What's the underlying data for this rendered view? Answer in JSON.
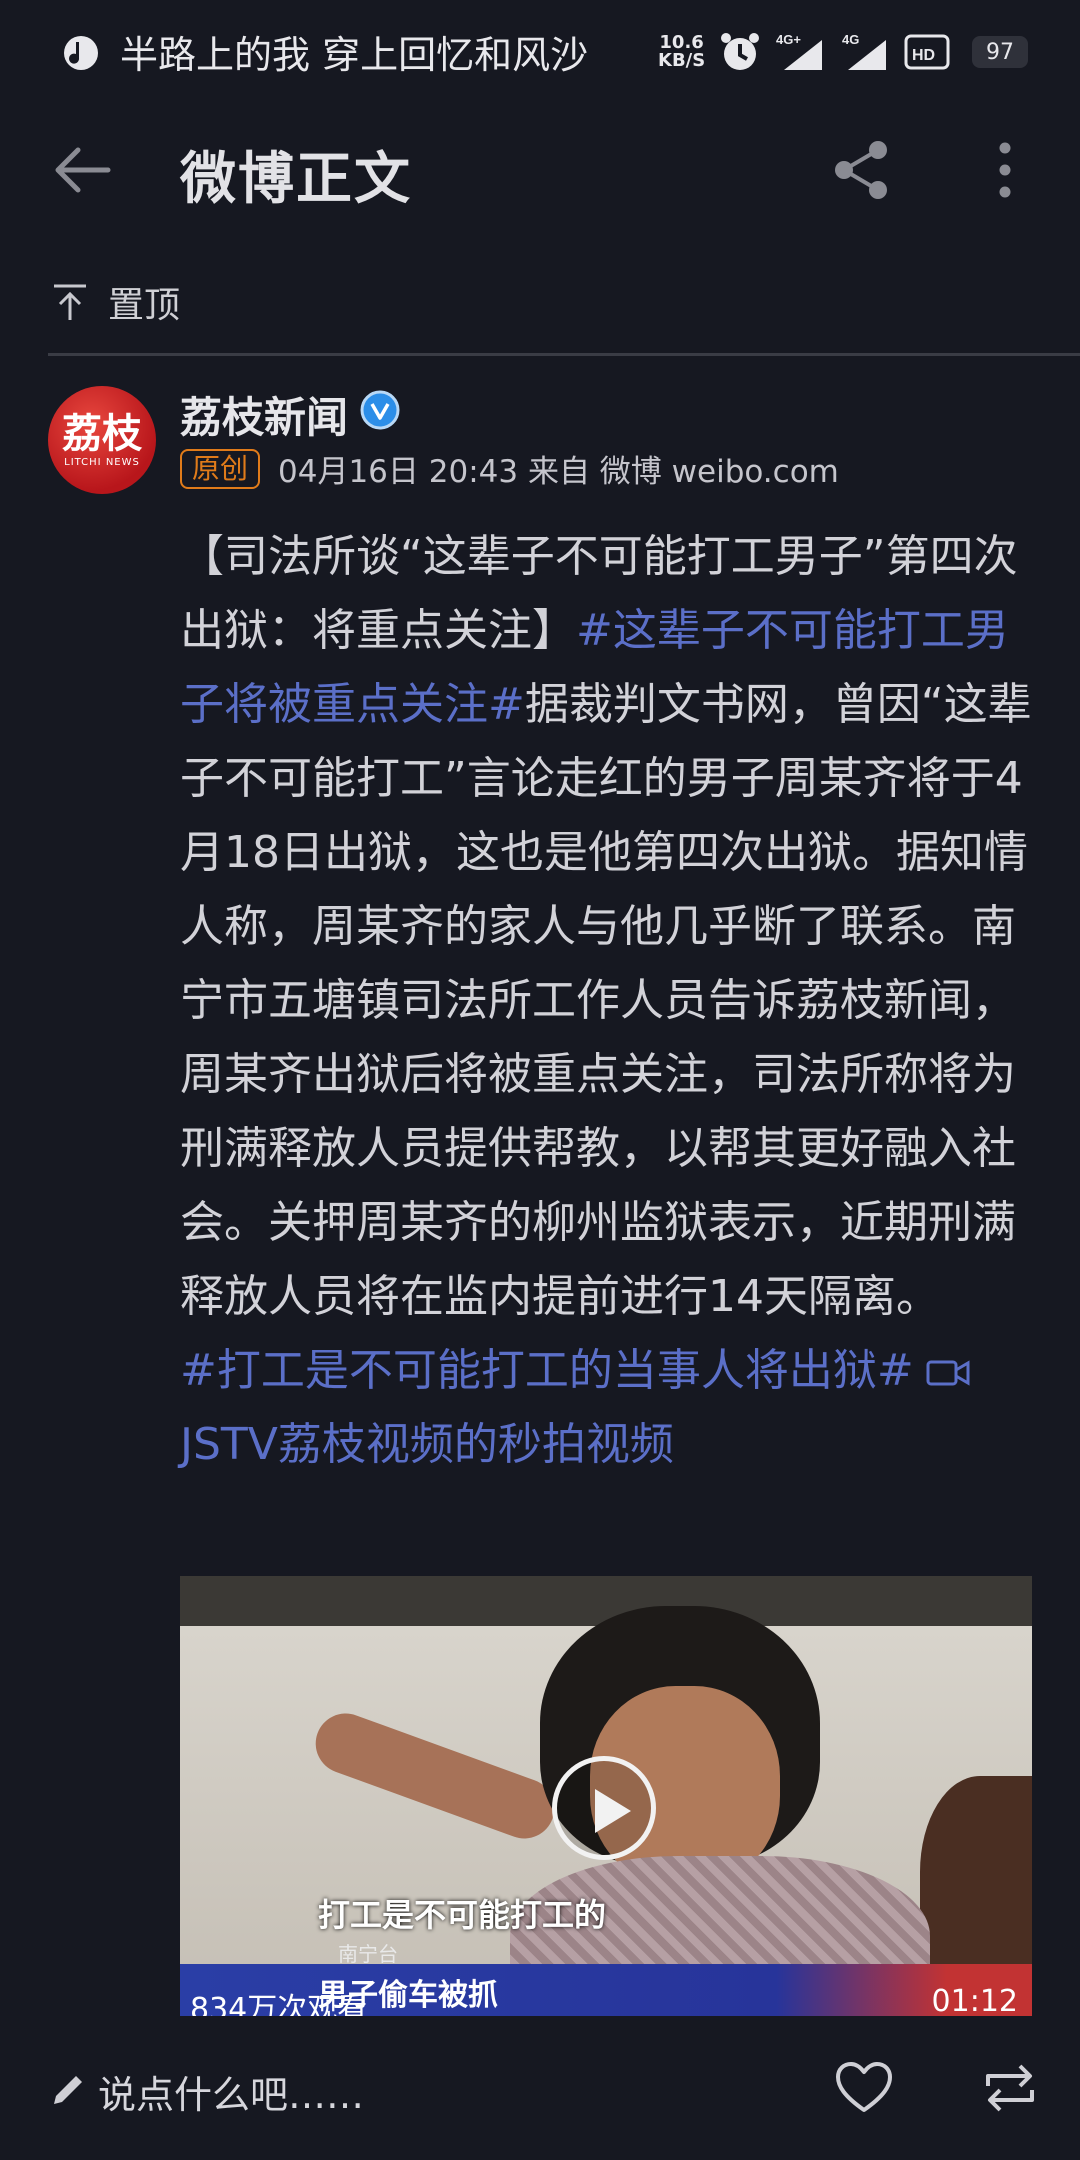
{
  "status_bar": {
    "song": "半路上的我 穿上回忆和风沙",
    "net_speed_value": "10.6",
    "net_speed_unit": "KB/S",
    "battery": "97",
    "icons": [
      "music-icon",
      "alarm-icon",
      "signal-4g-plus-icon",
      "signal-4g-icon",
      "hd-call-icon",
      "battery-icon"
    ]
  },
  "header": {
    "title": "微博正文"
  },
  "pin": {
    "label": "置顶"
  },
  "author": {
    "avatar_text": "荔枝",
    "avatar_sub": "LITCHI NEWS",
    "name": "荔枝新闻",
    "badge": "原创",
    "meta": "04月16日 20:43  来自 微博 weibo.com"
  },
  "post": {
    "segments": [
      {
        "text": "【司法所谈“这辈子不可能打工男子”第四次出狱：将重点关注】",
        "hl": false
      },
      {
        "text": "#这辈子不可能打工男子将被重点关注#",
        "hl": true
      },
      {
        "text": "据裁判文书网，曾因“这辈子不可能打工”言论走红的男子周某齐将于4月18日出狱，这也是他第四次出狱。据知情人称，周某齐的家人与他几乎断了联系。南宁市五塘镇司法所工作人员告诉荔枝新闻，周某齐出狱后将被重点关注，司法所称将为刑满释放人员提供帮教，以帮其更好融入社会。关押周某齐的柳州监狱表示，近期刑满释放人员将在监内提前进行14天隔离。",
        "hl": false
      },
      {
        "text": "#打工是不可能打工的当事人将出狱#",
        "hl": true
      }
    ],
    "video_link": "JSTV荔枝视频的秒拍视频"
  },
  "video": {
    "subtitle": "打工是不可能打工的",
    "station": "南宁台",
    "ticker": "男子偷车被抓",
    "views": "834万次观看",
    "duration": "01:12"
  },
  "bottom": {
    "comment_placeholder": "说点什么吧……"
  },
  "colors": {
    "background": "#161821",
    "link": "#5b6fc8",
    "badge": "#e07b1a",
    "verified": "#2c8ee8"
  }
}
